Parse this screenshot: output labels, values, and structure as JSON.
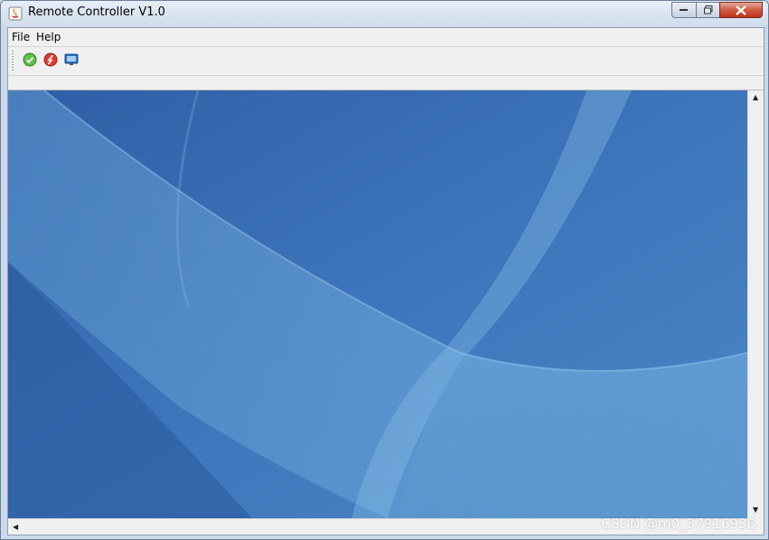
{
  "window": {
    "title": "Remote Controller V1.0"
  },
  "menubar": {
    "items": [
      {
        "label": "File"
      },
      {
        "label": "Help"
      }
    ]
  },
  "toolbar": {
    "buttons": [
      {
        "icon": "start-icon",
        "color": "#3aa83a"
      },
      {
        "icon": "stop-icon",
        "color": "#d8261f"
      },
      {
        "icon": "monitor-icon",
        "color": "#2a6fc0"
      }
    ]
  },
  "viewport": {
    "background": "remote-desktop-wallpaper",
    "colors": {
      "dark": "#2f5fa6",
      "mid": "#4a86c4",
      "light": "#6fa8d8"
    }
  },
  "watermark": {
    "text": "CSDN @m0_37916936"
  }
}
